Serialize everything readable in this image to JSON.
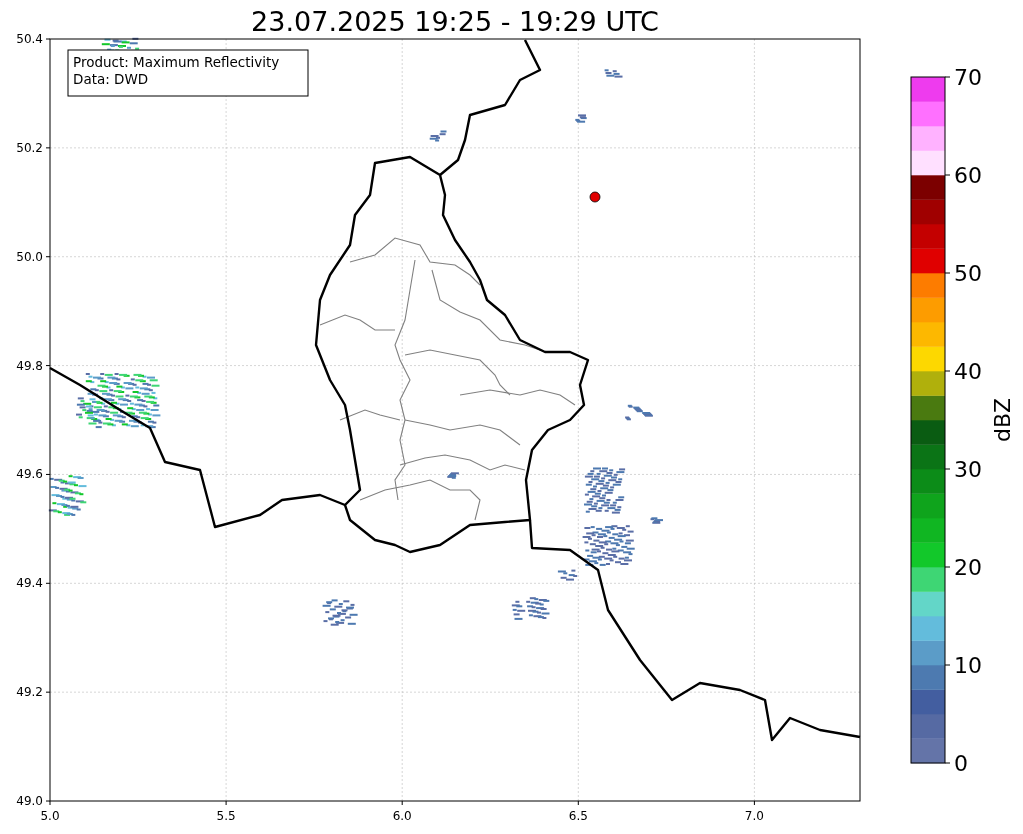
{
  "title": "23.07.2025 19:25 - 19:29 UTC",
  "legend": {
    "lines": [
      "Product: Maximum Reflectivity",
      "Data: DWD"
    ]
  },
  "x_axis": {
    "ticks": [
      "5.0",
      "5.5",
      "6.0",
      "6.5",
      "7.0"
    ]
  },
  "y_axis": {
    "ticks": [
      "50.4",
      "50.2",
      "50.0",
      "49.8",
      "49.6",
      "49.4",
      "49.2",
      "49.0"
    ]
  },
  "colorbar": {
    "label": "dBZ",
    "ticks": [
      "70",
      "60",
      "50",
      "40",
      "30",
      "20",
      "10",
      "0"
    ],
    "bins": [
      {
        "color": "#6474a8"
      },
      {
        "color": "#566aa3"
      },
      {
        "color": "#435ea0"
      },
      {
        "color": "#4d7ab0"
      },
      {
        "color": "#5b9cc8"
      },
      {
        "color": "#63bcdc"
      },
      {
        "color": "#63d6c8"
      },
      {
        "color": "#3ed674"
      },
      {
        "color": "#12c82a"
      },
      {
        "color": "#10b622"
      },
      {
        "color": "#0fa41c"
      },
      {
        "color": "#0c8c18"
      },
      {
        "color": "#0b7416"
      },
      {
        "color": "#0a5c12"
      },
      {
        "color": "#4a7a10"
      },
      {
        "color": "#b0b00c"
      },
      {
        "color": "#fdd800"
      },
      {
        "color": "#fdb800"
      },
      {
        "color": "#fd9c00"
      },
      {
        "color": "#fd7c00"
      },
      {
        "color": "#e00000"
      },
      {
        "color": "#c40000"
      },
      {
        "color": "#a00000"
      },
      {
        "color": "#7c0000"
      },
      {
        "color": "#ffe0ff"
      },
      {
        "color": "#ffb2ff"
      },
      {
        "color": "#ff70ff"
      },
      {
        "color": "#ee3bee"
      }
    ]
  }
}
